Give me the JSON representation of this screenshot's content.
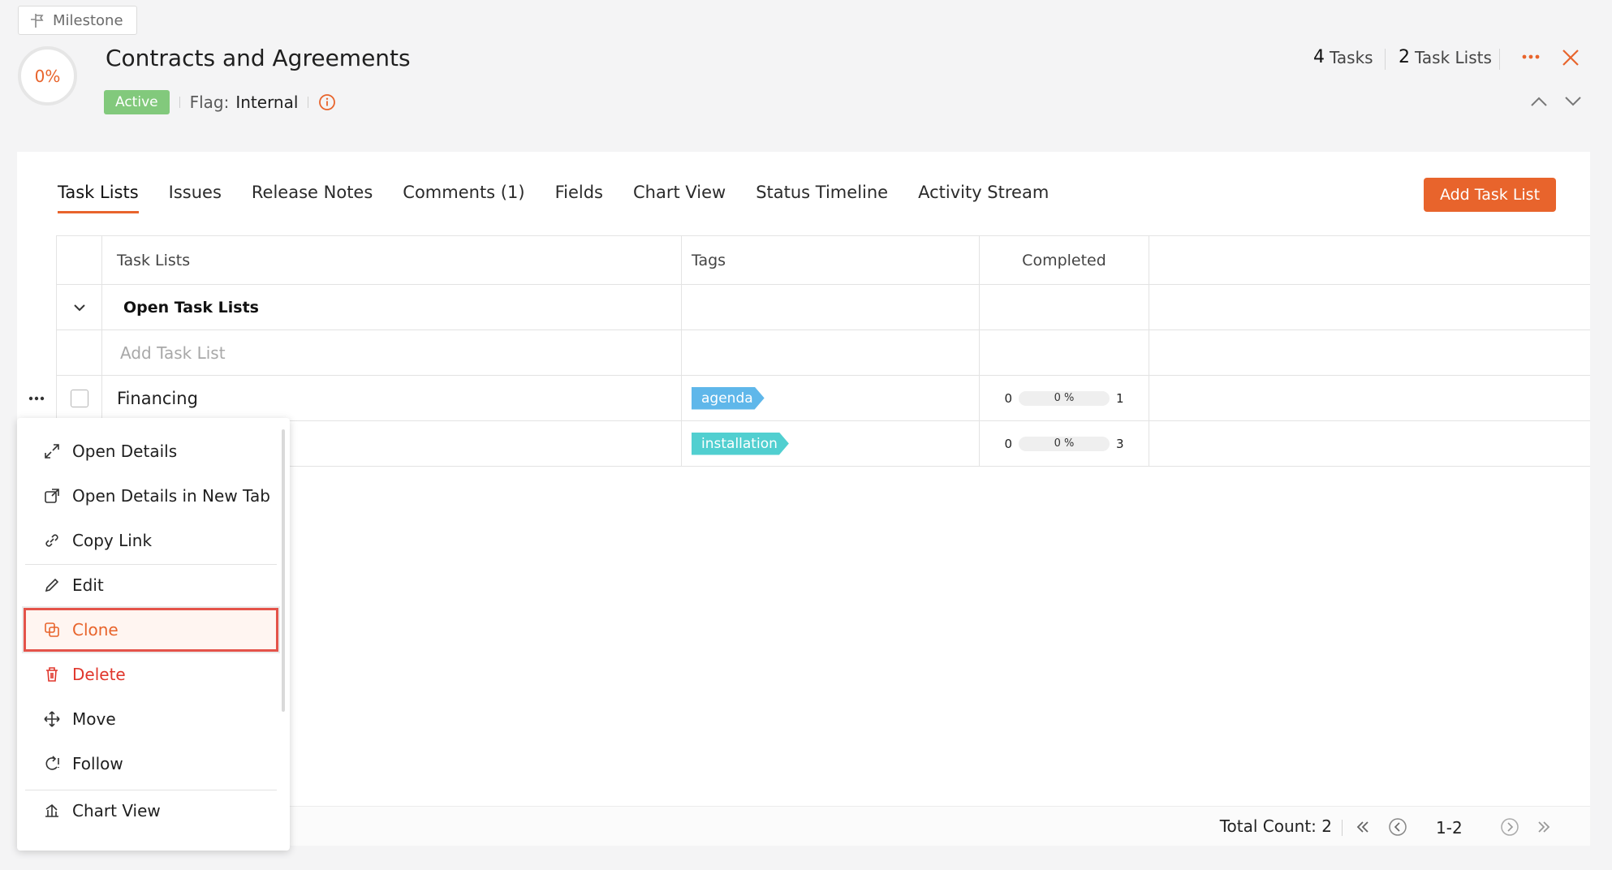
{
  "header": {
    "milestone_chip": "Milestone",
    "progress": "0%",
    "title": "Contracts and Agreements",
    "status": "Active",
    "flag_label": "Flag:",
    "flag_value": "Internal",
    "tasks_count": "4",
    "tasks_label": "Tasks",
    "tasklists_count": "2",
    "tasklists_label": "Task Lists"
  },
  "tabs": [
    {
      "label": "Task Lists"
    },
    {
      "label": "Issues"
    },
    {
      "label": "Release Notes"
    },
    {
      "label": "Comments (1)"
    },
    {
      "label": "Fields"
    },
    {
      "label": "Chart View"
    },
    {
      "label": "Status Timeline"
    },
    {
      "label": "Activity Stream"
    }
  ],
  "add_button": "Add Task List",
  "table": {
    "columns": [
      "Task Lists",
      "Tags",
      "Completed"
    ],
    "group_label": "Open Task Lists",
    "add_placeholder": "Add Task List",
    "rows": [
      {
        "name": "Financing",
        "tag": "agenda",
        "done": "0",
        "percent": "0 %",
        "total": "1"
      },
      {
        "name": "",
        "tag": "installation",
        "done": "0",
        "percent": "0 %",
        "total": "3"
      }
    ]
  },
  "footer": {
    "total_count": "Total Count: 2",
    "range": "1-2"
  },
  "menu": {
    "items": [
      {
        "label": "Open Details",
        "icon": "expand-icon"
      },
      {
        "label": "Open Details in New Tab",
        "icon": "new-tab-icon"
      },
      {
        "label": "Copy Link",
        "icon": "link-icon"
      },
      {
        "label": "Edit",
        "icon": "pencil-icon"
      },
      {
        "label": "Clone",
        "icon": "clone-icon"
      },
      {
        "label": "Delete",
        "icon": "trash-icon"
      },
      {
        "label": "Move",
        "icon": "move-icon"
      },
      {
        "label": "Follow",
        "icon": "follow-icon"
      },
      {
        "label": "Chart View",
        "icon": "chart-icon"
      }
    ]
  },
  "colors": {
    "accent": "#e8642c",
    "active_badge": "#82c97c",
    "tag_blue": "#5fb7ea",
    "tag_teal": "#51cfd0",
    "delete": "#e0362c",
    "highlight_outline": "#e4534a"
  }
}
